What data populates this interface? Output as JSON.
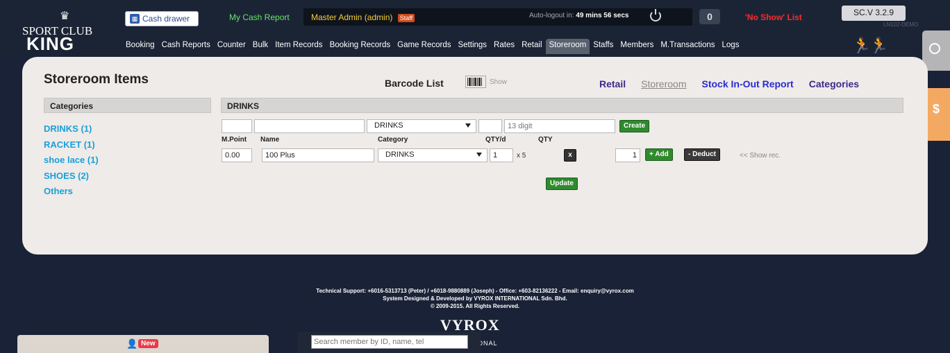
{
  "header": {
    "logo_line1": "SPORT CLUB",
    "logo_line2": "KING",
    "cash_drawer_label": "Cash drawer",
    "my_cash_report": "My Cash Report",
    "user_label": "Master Admin (admin)",
    "user_role": "Staff",
    "autologout_prefix": "Auto-logout in:",
    "autologout_time": "49 mins 56 secs",
    "count": "0",
    "no_show_label": "'No Show' List",
    "version": "SC.V 3.2.9",
    "instance": "LN102-DEMO"
  },
  "nav": [
    {
      "label": "Booking"
    },
    {
      "label": "Cash Reports"
    },
    {
      "label": "Counter"
    },
    {
      "label": "Bulk"
    },
    {
      "label": "Item Records"
    },
    {
      "label": "Booking Records"
    },
    {
      "label": "Game Records"
    },
    {
      "label": "Settings"
    },
    {
      "label": "Rates"
    },
    {
      "label": "Retail"
    },
    {
      "label": "Storeroom",
      "active": true
    },
    {
      "label": "Staffs"
    },
    {
      "label": "Members"
    },
    {
      "label": "M.Transactions"
    },
    {
      "label": "Logs"
    }
  ],
  "side_tabs": {
    "cash_tab_symbol": "$"
  },
  "page": {
    "title": "Storeroom Items",
    "barcode_label": "Barcode List",
    "barcode_show": "Show",
    "links": {
      "retail": "Retail",
      "storeroom": "Storeroom",
      "stock_report": "Stock In-Out Report",
      "categories": "Categories"
    }
  },
  "categories": {
    "heading": "Categories",
    "items": [
      {
        "label": "DRINKS (1)"
      },
      {
        "label": "RACKET (1)"
      },
      {
        "label": "shoe lace (1)"
      },
      {
        "label": "SHOES (2)"
      },
      {
        "label": "Others"
      }
    ]
  },
  "section": {
    "heading": "DRINKS",
    "create_row": {
      "mpoint": "",
      "name": "",
      "category": "DRINKS",
      "qty": "",
      "barcode_placeholder": "13 digit",
      "create_label": "Create"
    },
    "columns": {
      "mpoint": "M.Point",
      "name": "Name",
      "category": "Category",
      "qtyd": "QTY/d",
      "qty": "QTY"
    },
    "items": [
      {
        "mpoint": "0.00",
        "name": "100 Plus",
        "category": "DRINKS",
        "qtyd": "1",
        "multiplier": "x 5",
        "remove_label": "x",
        "amount": "1",
        "add_label": "+ Add",
        "deduct_label": "- Deduct",
        "show_rec": "<< Show rec."
      }
    ],
    "update_label": "Update"
  },
  "footer": {
    "line1": "Technical Support: +6016-5313713 (Peter) / +6018-9880889 (Joseph) - Office: +603-82136222 - Email: enquiry@vyrox.com",
    "line2": "System Designed & Developed by VYROX INTERNATIONAL Sdn. Bhd.",
    "line3": "© 2009-2015. All Rights Reserved.",
    "brand": "VYROX",
    "brand_sub": "TIONAL"
  },
  "bottom": {
    "new_badge": "New",
    "search_placeholder": "Search member by ID, name, tel"
  },
  "colors": {
    "background": "#192236",
    "panel": "#efebe9",
    "category_link": "#1aa0d8",
    "button_green": "#2f8a2c",
    "no_show_red": "#ff2a2a",
    "staff_badge": "#d04a1a",
    "side_tab_orange": "#f4a962"
  }
}
